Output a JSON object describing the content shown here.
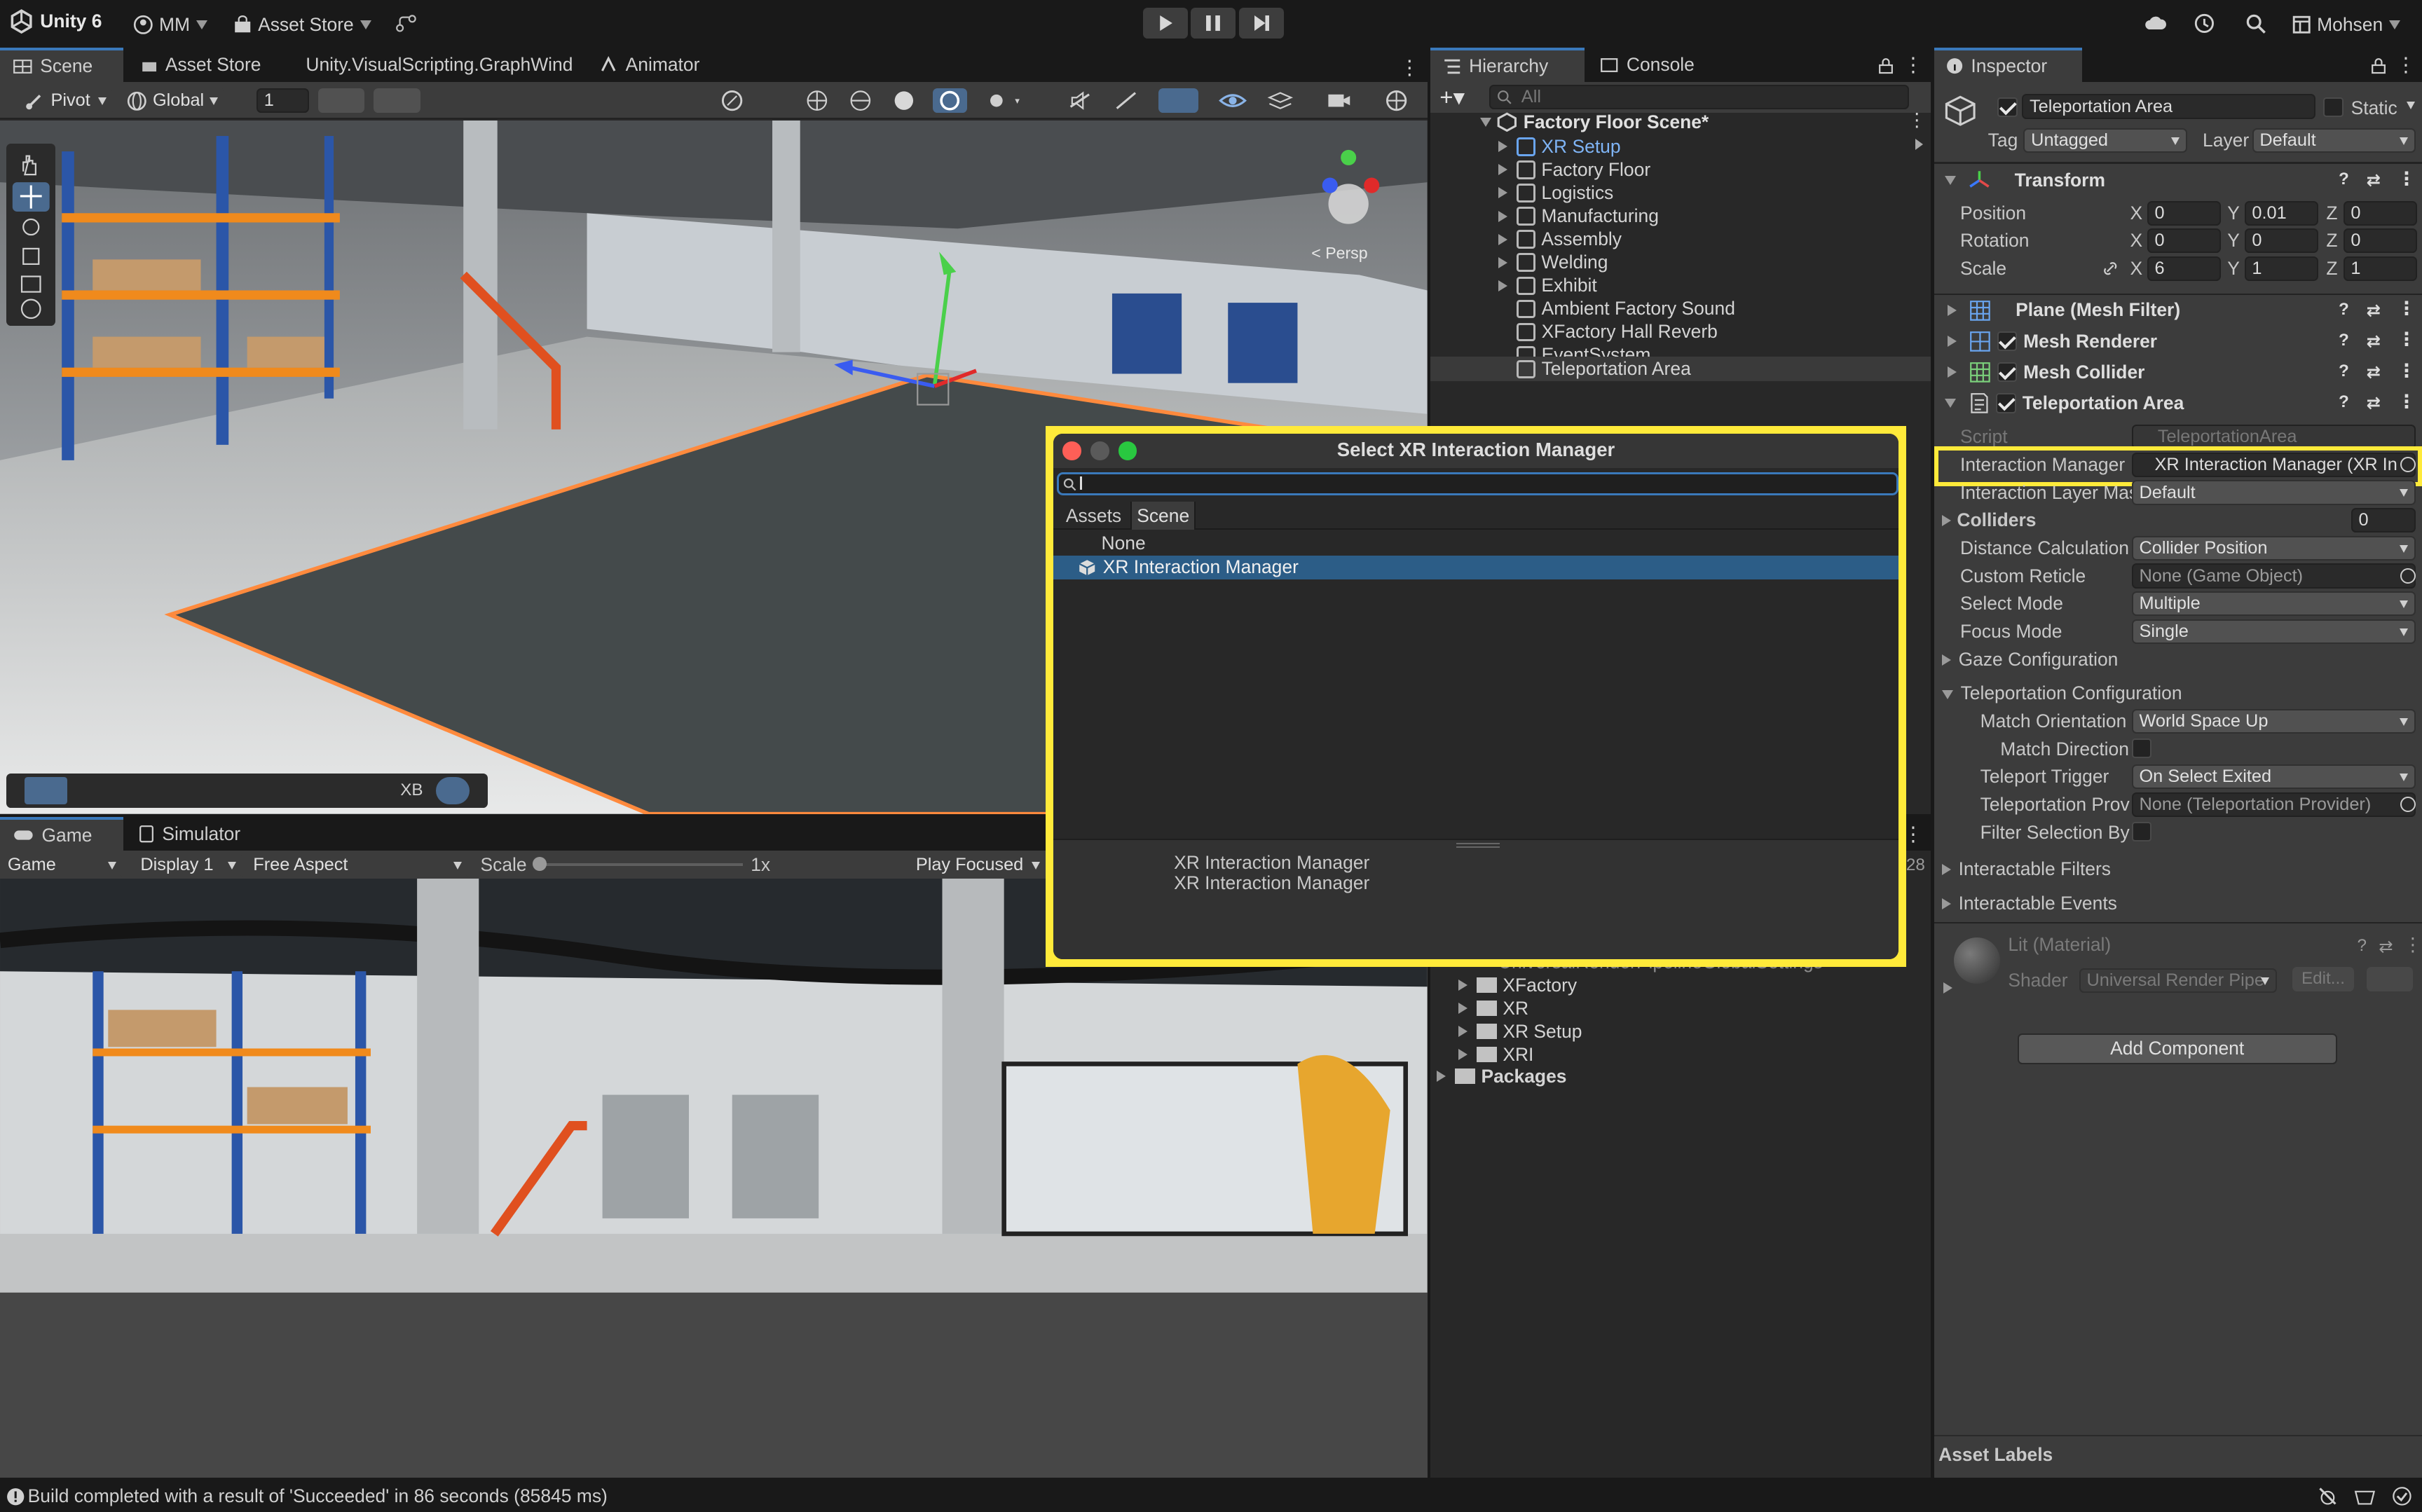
{
  "toolbar": {
    "app": "Unity 6",
    "account": "MM",
    "asset_store": "Asset Store",
    "user": "Mohsen"
  },
  "scene_tabs": [
    "Scene",
    "Asset Store",
    "Unity.VisualScripting.GraphWindo",
    "Animator"
  ],
  "scene_toolbar": {
    "pivot": "Pivot",
    "global": "Global",
    "grid": "1",
    "overlay_xb": "XB",
    "persp": "< Persp"
  },
  "game_tabs": [
    "Game",
    "Simulator"
  ],
  "game_toolbar": {
    "mode": "Game",
    "display": "Display 1",
    "aspect": "Free Aspect",
    "scale_label": "Scale",
    "scale_value": "1x",
    "play_focused": "Play Focused",
    "stat": "28"
  },
  "hierarchy": {
    "tabs": [
      "Hierarchy",
      "Console"
    ],
    "search_placeholder": "All",
    "scene": "Factory Floor Scene*",
    "items": [
      "XR Setup",
      "Factory Floor",
      "Logistics",
      "Manufacturing",
      "Assembly",
      "Welding",
      "Exhibit",
      "Ambient Factory Sound",
      "XFactory Hall Reverb",
      "EventSystem",
      "Teleportation Area"
    ]
  },
  "project": {
    "clipped": "UniversalRenderPipelineGlobalSettings",
    "items": [
      "XFactory",
      "XR",
      "XR Setup",
      "XRI"
    ],
    "packages": "Packages"
  },
  "inspector": {
    "tab": "Inspector",
    "object_name": "Teleportation Area",
    "static": "Static",
    "tag_label": "Tag",
    "tag": "Untagged",
    "layer_label": "Layer",
    "layer": "Default",
    "transform": "Transform",
    "position": {
      "label": "Position",
      "x": "0",
      "y": "0.01",
      "z": "0"
    },
    "rotation": {
      "label": "Rotation",
      "x": "0",
      "y": "0",
      "z": "0"
    },
    "scale": {
      "label": "Scale",
      "x": "6",
      "y": "1",
      "z": "1"
    },
    "axis": {
      "x": "X",
      "y": "Y",
      "z": "Z"
    },
    "components": [
      "Plane (Mesh Filter)",
      "Mesh Renderer",
      "Mesh Collider",
      "Teleportation Area"
    ],
    "script_label": "Script",
    "script_value": "TeleportationArea",
    "fields": [
      {
        "label": "Interaction Manager",
        "value": "XR Interaction Manager (XR In"
      },
      {
        "label": "Interaction Layer Mas",
        "value": "Default"
      },
      {
        "label": "Colliders",
        "value": "0"
      },
      {
        "label": "Distance Calculation",
        "value": "Collider Position"
      },
      {
        "label": "Custom Reticle",
        "value": "None (Game Object)"
      },
      {
        "label": "Select Mode",
        "value": "Multiple"
      },
      {
        "label": "Focus Mode",
        "value": "Single"
      },
      {
        "label": "Gaze Configuration",
        "value": ""
      },
      {
        "label": "Teleportation Configuration",
        "value": ""
      },
      {
        "label": "Match Orientation",
        "value": "World Space Up"
      },
      {
        "label": "Match Direction",
        "value": ""
      },
      {
        "label": "Teleport Trigger",
        "value": "On Select Exited"
      },
      {
        "label": "Teleportation Prov",
        "value": "None (Teleportation Provider)"
      },
      {
        "label": "Filter Selection By",
        "value": ""
      },
      {
        "label": "Interactable Filters",
        "value": ""
      },
      {
        "label": "Interactable Events",
        "value": ""
      }
    ],
    "material": "Lit (Material)",
    "shader_label": "Shader",
    "shader": "Universal Render Pipe",
    "edit": "Edit...",
    "add_component": "Add Component",
    "asset_labels": "Asset Labels"
  },
  "dialog": {
    "title": "Select XR Interaction Manager",
    "tabs": [
      "Assets",
      "Scene"
    ],
    "items": [
      "None",
      "XR Interaction Manager"
    ],
    "preview_line1": "XR Interaction Manager",
    "preview_line2": "XR Interaction Manager"
  },
  "status": "Build completed with a result of 'Succeeded' in 86 seconds (85845 ms)",
  "colors": {
    "accent": "#3a79bb",
    "highlight": "#ffea3a",
    "selection": "#2c5d87"
  }
}
